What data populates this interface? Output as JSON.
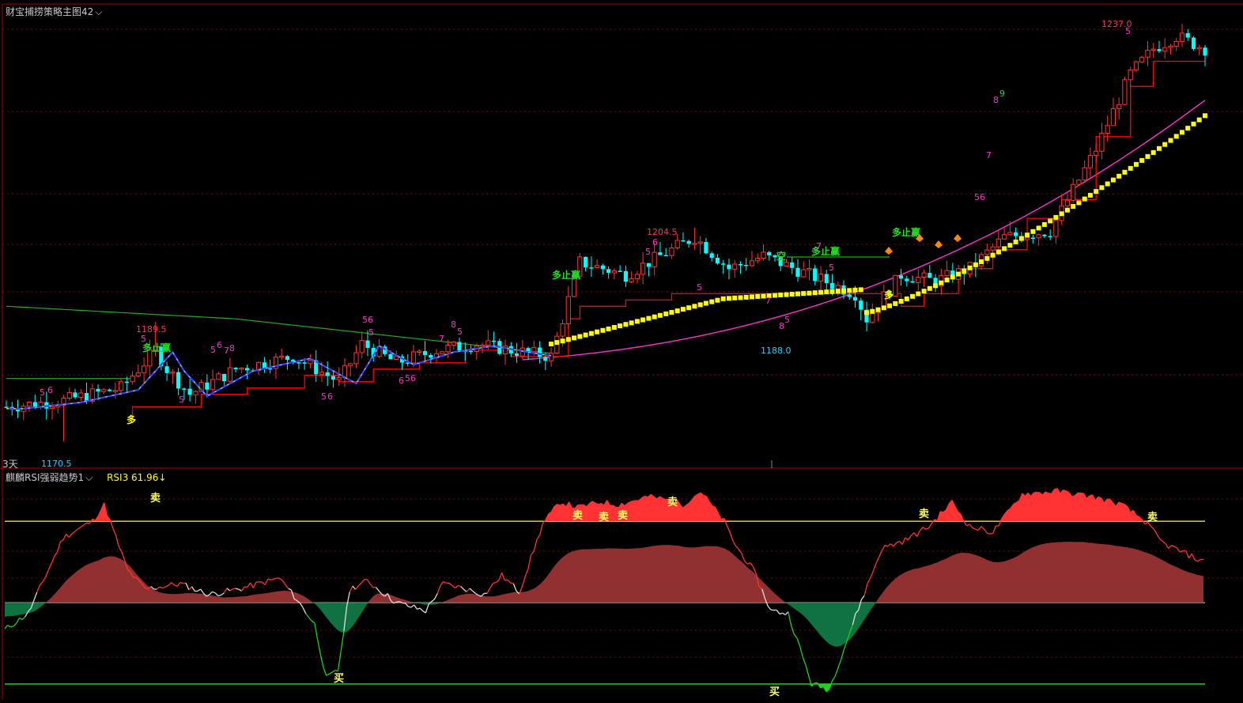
{
  "header": {
    "main_title": "财宝捕捞策略主图42",
    "sub_title": "麒麟RSI强弱趋势1",
    "rsi_label": "RSI3",
    "rsi_value": "61.96",
    "rsi_arrow": "↓",
    "period": "3天"
  },
  "icons": {
    "dropdown": "chevron-down-icon"
  },
  "colors": {
    "background": "#000000",
    "up": "#ff3333",
    "down": "#00ffff",
    "ma_yellow": "#ffff00",
    "stop_red": "#ff0000",
    "ma_magenta": "#ff33cc",
    "ma_green": "#22aa22",
    "rsi_red": "#ff3333",
    "rsi_green": "#22cc22",
    "fill_red": "#ff3333",
    "fill_brown": "#993333",
    "fill_teal": "#117744",
    "threshold_yellow": "#ffdd44",
    "threshold_green": "#22cc22",
    "seq_magenta": "#ff33cc",
    "seq_green": "#22dd22"
  },
  "chart_data": [
    {
      "type": "candlestick",
      "price_range": [
        1168,
        1240
      ],
      "annotations_price": [
        {
          "text": "1189.5",
          "kind": "high"
        },
        {
          "text": "1170.5",
          "kind": "low"
        },
        {
          "text": "1204.5",
          "kind": "high"
        },
        {
          "text": "1188.0",
          "kind": "low"
        },
        {
          "text": "1237.0",
          "kind": "high"
        }
      ],
      "signals": [
        {
          "text": "多止赢",
          "color": "#22dd22"
        },
        {
          "text": "多止赢",
          "color": "#22dd22"
        },
        {
          "text": "多止赢",
          "color": "#22dd22"
        },
        {
          "text": "多止赢",
          "color": "#22dd22"
        },
        {
          "text": "空",
          "color": "#22dd22"
        },
        {
          "text": "多",
          "color": "#ffff00"
        },
        {
          "text": "多",
          "color": "#ffff00"
        }
      ],
      "sequence_numbers": [
        {
          "text": "5",
          "color": "#ff33cc"
        },
        {
          "text": "6",
          "color": "#ff33cc"
        },
        {
          "text": "5",
          "color": "#ff33cc"
        },
        {
          "text": "5",
          "color": "#ff33cc"
        },
        {
          "text": "5",
          "color": "#ff33cc"
        },
        {
          "text": "6",
          "color": "#ff33cc"
        },
        {
          "text": "7",
          "color": "#ff33cc"
        },
        {
          "text": "8",
          "color": "#ff33cc"
        },
        {
          "text": "5",
          "color": "#ff33cc"
        },
        {
          "text": "6",
          "color": "#ff33cc"
        },
        {
          "text": "56",
          "color": "#ff33cc"
        },
        {
          "text": "5",
          "color": "#ff33cc"
        },
        {
          "text": "6",
          "color": "#ff33cc"
        },
        {
          "text": "56",
          "color": "#ff33cc"
        },
        {
          "text": "7",
          "color": "#ff33cc"
        },
        {
          "text": "8",
          "color": "#ff33cc"
        },
        {
          "text": "5",
          "color": "#ff33cc"
        },
        {
          "text": "6",
          "color": "#ff33cc"
        },
        {
          "text": "5",
          "color": "#ff33cc"
        },
        {
          "text": "5",
          "color": "#ff33cc"
        },
        {
          "text": "7",
          "color": "#ff33cc"
        },
        {
          "text": "8",
          "color": "#ff33cc"
        },
        {
          "text": "5",
          "color": "#ff33cc"
        },
        {
          "text": "7",
          "color": "#ff33cc"
        },
        {
          "text": "5",
          "color": "#ff33cc"
        },
        {
          "text": "56",
          "color": "#ff33cc"
        },
        {
          "text": "7",
          "color": "#ff33cc"
        },
        {
          "text": "8",
          "color": "#ff33cc"
        },
        {
          "text": "9",
          "color": "#22dd22"
        },
        {
          "text": "5",
          "color": "#ff33cc"
        }
      ]
    },
    {
      "type": "area",
      "indicator": "RSI",
      "levels": {
        "upper": 80,
        "middle": 50,
        "lower": 20
      },
      "range": [
        20,
        92
      ],
      "signals": [
        {
          "text": "卖"
        },
        {
          "text": "卖"
        },
        {
          "text": "卖"
        },
        {
          "text": "卖"
        },
        {
          "text": "卖"
        },
        {
          "text": "卖"
        },
        {
          "text": "卖"
        },
        {
          "text": "买"
        },
        {
          "text": "买"
        }
      ]
    }
  ]
}
